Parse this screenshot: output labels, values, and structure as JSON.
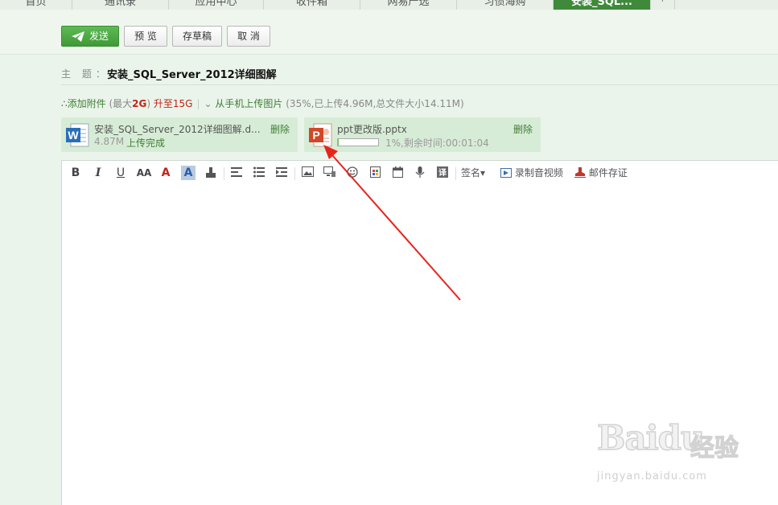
{
  "tabs": [
    "首页",
    "通讯录",
    "应用中心",
    "收件箱",
    "网易严选",
    "习惯海购",
    "安装_SQL...",
    "+"
  ],
  "toolbar": {
    "send": "发送",
    "preview": "预 览",
    "draft": "存草稿",
    "cancel": "取 消"
  },
  "subject": {
    "label": "主 题：",
    "value": "安装_SQL_Server_2012详细图解"
  },
  "attach_bar": {
    "add": "添加附件",
    "max_prefix": "(最大",
    "max_value": "2G",
    "max_suffix": ")",
    "upgrade": "升至15G",
    "mobile": "从手机上传图片",
    "progress_info": "(35%,已上传4.96M,总文件大小14.11M)"
  },
  "attachments": [
    {
      "name": "安装_SQL_Server_2012详细图解.d...",
      "size": "4.87M",
      "status": "上传完成",
      "delete": "删除",
      "icon": "word-file-icon"
    },
    {
      "name": "ppt更改版.pptx",
      "progress_text": "1%,剩余时间:00:01:04",
      "progress": 0.01,
      "delete": "删除",
      "icon": "powerpoint-file-icon"
    }
  ],
  "editor_toolbar": {
    "bold": "B",
    "italic": "I",
    "underline": "U",
    "font_size": "AA",
    "font_color": "A",
    "bg_color": "A",
    "signature": "签名",
    "record_video": "录制音视频",
    "mail_archive": "邮件存证"
  },
  "watermark": {
    "brand": "Bai",
    "brand2": "du",
    "cn": "经验",
    "url": "jingyan.baidu.com"
  },
  "colors": {
    "accent_green": "#3f9937",
    "tab_active": "#3f8a3a",
    "link_green": "#3e7f35",
    "alert_red": "#c0251a",
    "arrow_red": "#e8231a"
  }
}
